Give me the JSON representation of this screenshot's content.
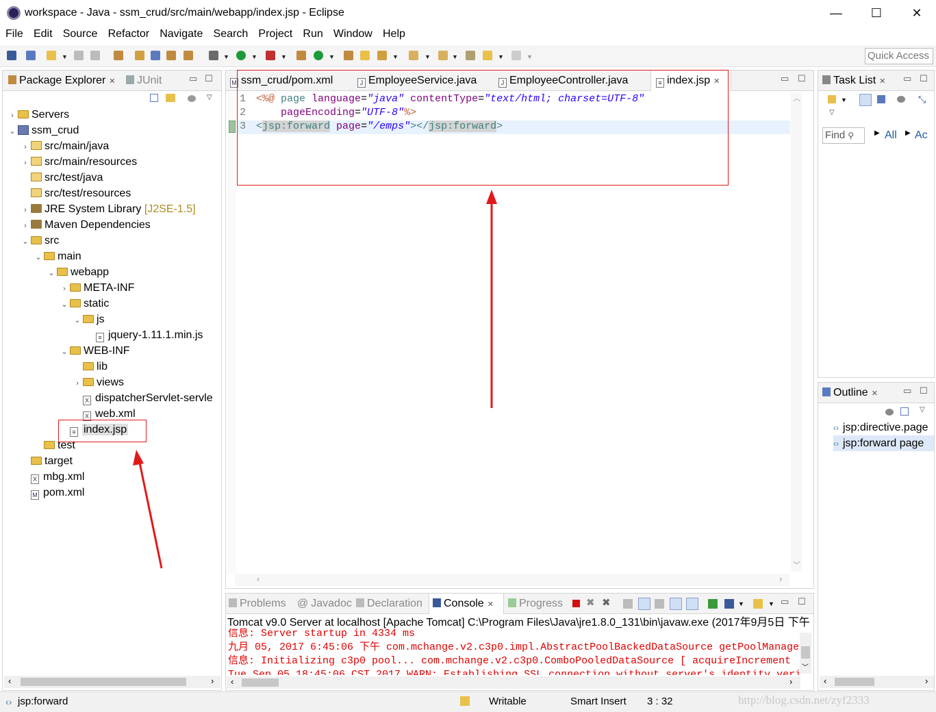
{
  "window": {
    "title": "workspace - Java - ssm_crud/src/main/webapp/index.jsp - Eclipse",
    "min": "—",
    "max": "☐",
    "close": "✕"
  },
  "menu": [
    "File",
    "Edit",
    "Source",
    "Refactor",
    "Navigate",
    "Search",
    "Project",
    "Run",
    "Window",
    "Help"
  ],
  "quick_access": {
    "placeholder": "Quick Access"
  },
  "left_panel": {
    "tabs": [
      {
        "label": "Package Explorer",
        "active": true
      },
      {
        "label": "JUnit",
        "active": false
      }
    ],
    "tree": [
      {
        "label": "Servers",
        "extra": ""
      },
      {
        "label": "ssm_crud",
        "extra": ""
      },
      {
        "label": "src/main/java",
        "extra": ""
      },
      {
        "label": "src/main/resources",
        "extra": ""
      },
      {
        "label": "src/test/java",
        "extra": ""
      },
      {
        "label": "src/test/resources",
        "extra": ""
      },
      {
        "label": "JRE System Library",
        "extra": "[J2SE-1.5]"
      },
      {
        "label": "Maven Dependencies",
        "extra": ""
      },
      {
        "label": "src",
        "extra": ""
      },
      {
        "label": "main",
        "extra": ""
      },
      {
        "label": "webapp",
        "extra": ""
      },
      {
        "label": "META-INF",
        "extra": ""
      },
      {
        "label": "static",
        "extra": ""
      },
      {
        "label": "js",
        "extra": ""
      },
      {
        "label": "jquery-1.11.1.min.js",
        "extra": ""
      },
      {
        "label": "WEB-INF",
        "extra": ""
      },
      {
        "label": "lib",
        "extra": ""
      },
      {
        "label": "views",
        "extra": ""
      },
      {
        "label": "dispatcherServlet-servle",
        "extra": ""
      },
      {
        "label": "web.xml",
        "extra": ""
      },
      {
        "label": "index.jsp",
        "extra": ""
      },
      {
        "label": "test",
        "extra": ""
      },
      {
        "label": "target",
        "extra": ""
      },
      {
        "label": "mbg.xml",
        "extra": ""
      },
      {
        "label": "pom.xml",
        "extra": ""
      }
    ]
  },
  "editor": {
    "tabs": [
      {
        "label": "ssm_crud/pom.xml",
        "icon": "M"
      },
      {
        "label": "EmployeeService.java",
        "icon": "J"
      },
      {
        "label": "EmployeeController.java",
        "icon": "J"
      },
      {
        "label": "index.jsp",
        "icon": ""
      }
    ],
    "line_numbers": [
      "1",
      "2",
      "3"
    ],
    "code": {
      "l1_open": "<%@ ",
      "l1_page": "page ",
      "l1_lang": "language",
      "l1_eq1": "=",
      "l1_langv": "\"java\"",
      "l1_ct": " contentType",
      "l1_eq2": "=",
      "l1_ctv": "\"text/html; charset=UTF-8\"",
      "l2_pe": "    pageEncoding",
      "l2_eq": "=",
      "l2_pev": "\"UTF-8\"",
      "l2_close": "%>",
      "l3_lt": "<",
      "l3_tag": "jsp:forward",
      "l3_attr": " page",
      "l3_eq": "=",
      "l3_val": "\"/emps\"",
      "l3_gt": "></",
      "l3_tag2": "jsp:forward",
      "l3_end": ">"
    }
  },
  "right_top": {
    "tab": "Task List",
    "find": "Find",
    "all": "All",
    "ac": "Ac"
  },
  "outline": {
    "tab": "Outline",
    "items": [
      "jsp:directive.page",
      "jsp:forward page"
    ]
  },
  "bottom": {
    "tabs": [
      "Problems",
      "Javadoc",
      "Declaration",
      "Console",
      "Progress"
    ],
    "header": "Tomcat v9.0 Server at localhost [Apache Tomcat] C:\\Program Files\\Java\\jre1.8.0_131\\bin\\javaw.exe (2017年9月5日 下午",
    "lines": [
      "信息: Server startup in 4334 ms",
      "九月 05, 2017 6:45:06 下午 com.mchange.v2.c3p0.impl.AbstractPoolBackedDataSource getPoolManage",
      "信息: Initializing c3p0 pool... com.mchange.v2.c3p0.ComboPooledDataSource [ acquireIncrement",
      "Tue Sep 05 18:45:06 CST 2017 WARN: Establishing SSL connection without server's identity veri"
    ]
  },
  "status": {
    "left": "jsp:forward",
    "writable": "Writable",
    "insert": "Smart Insert",
    "pos": "3 : 32",
    "watermark": "http://blog.csdn.net/zyf2333"
  },
  "colors": {
    "annotation": "#e01a1a",
    "console_text": "#e00000"
  }
}
